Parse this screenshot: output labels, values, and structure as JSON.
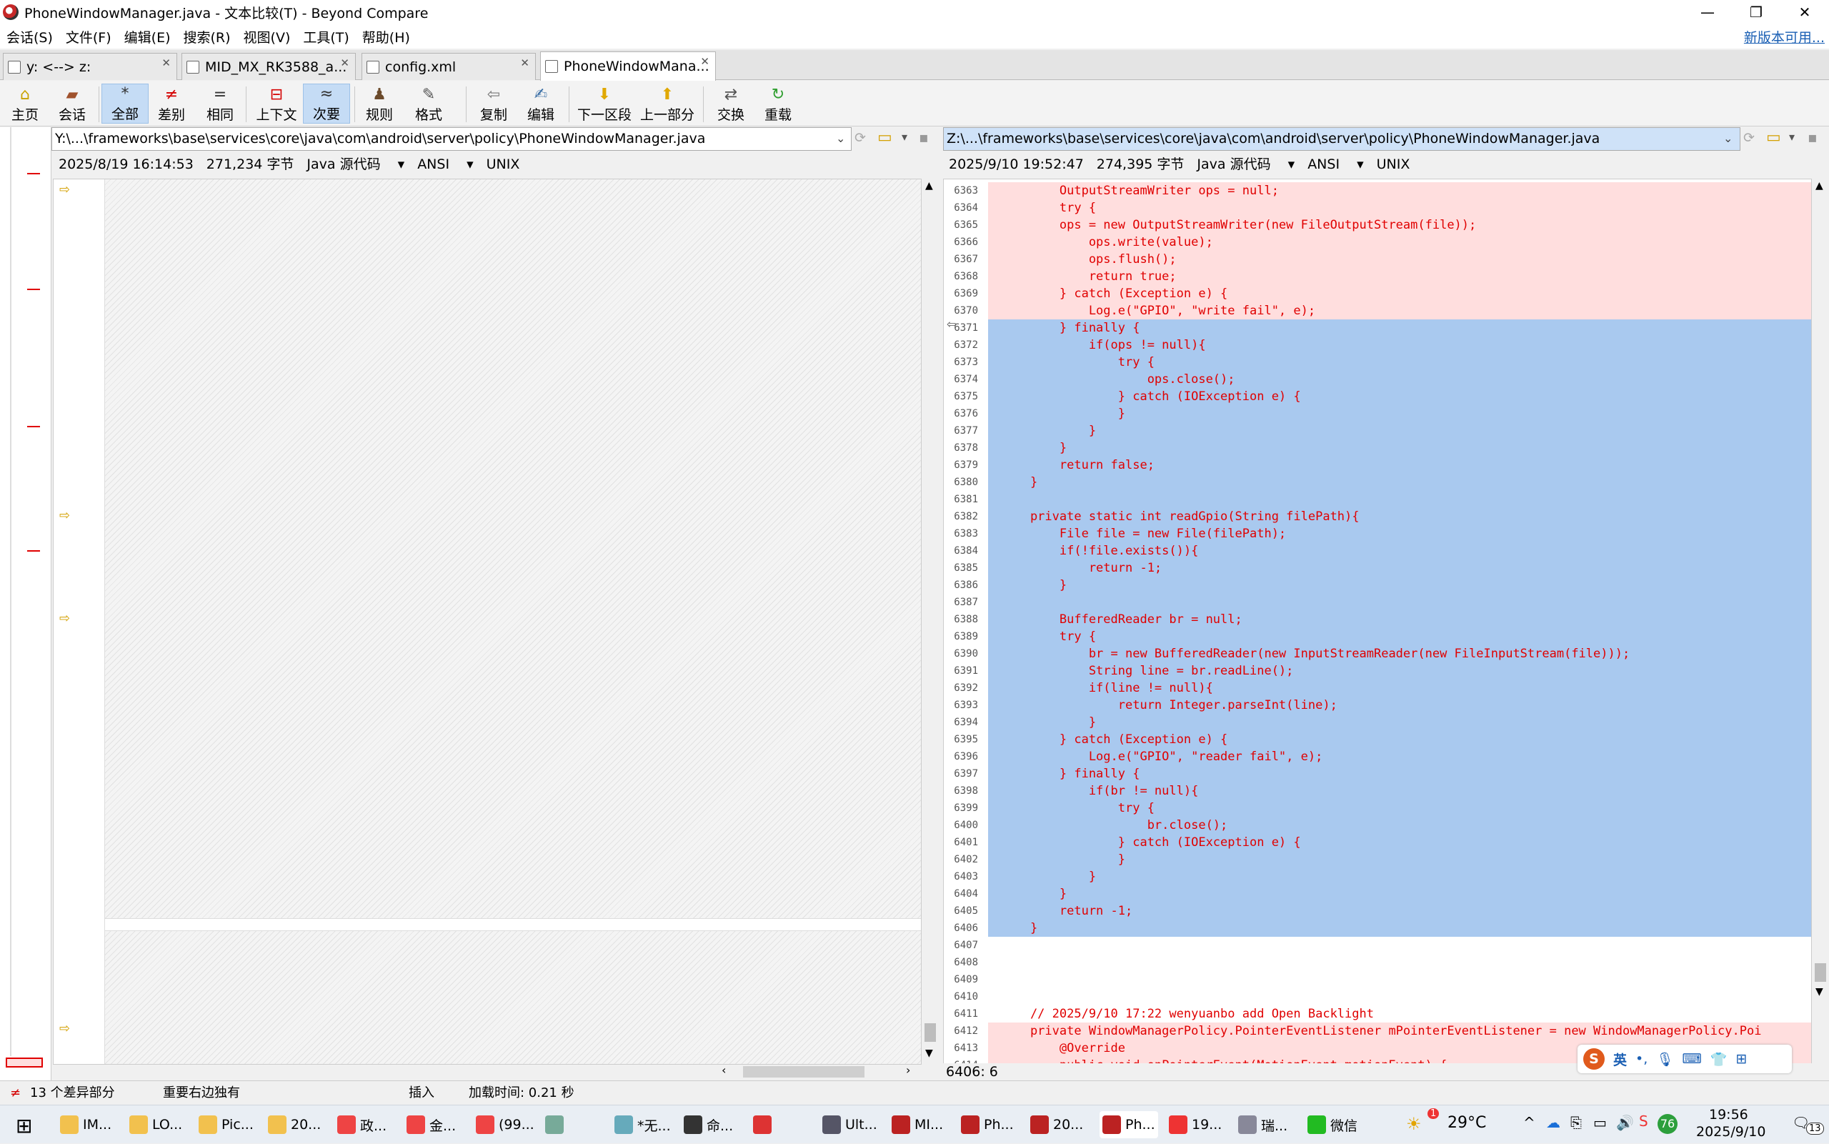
{
  "window": {
    "title": "PhoneWindowManager.java - 文本比较(T) - Beyond Compare"
  },
  "menu": {
    "items": [
      "会话(S)",
      "文件(F)",
      "编辑(E)",
      "搜索(R)",
      "视图(V)",
      "工具(T)",
      "帮助(H)"
    ],
    "new_version": "新版本可用..."
  },
  "tabs": [
    "y: <--> z:",
    "MID_MX_RK3588_a...",
    "config.xml",
    "PhoneWindowMana..."
  ],
  "toolbar": {
    "home": "主页",
    "session": "会话",
    "all": "全部",
    "diffs": "差别",
    "same": "相同",
    "context": "上下文",
    "minor": "次要",
    "rules": "规则",
    "format": "格式",
    "copy": "复制",
    "edit": "编辑",
    "next_section": "下一区段",
    "prev_section": "上一部分",
    "swap": "交换",
    "reload": "重载"
  },
  "left": {
    "path": "Y:\\...\\frameworks\\base\\services\\core\\java\\com\\android\\server\\policy\\PhoneWindowManager.java",
    "date": "2025/8/19 16:14:53",
    "size": "271,234 字节",
    "format": "Java 源代码",
    "encoding": "ANSI",
    "eol": "UNIX"
  },
  "right": {
    "path": "Z:\\...\\frameworks\\base\\services\\core\\java\\com\\android\\server\\policy\\PhoneWindowManager.java",
    "date": "2025/9/10 19:52:47",
    "size": "274,395 字节",
    "format": "Java 源代码",
    "encoding": "ANSI",
    "eol": "UNIX"
  },
  "code": [
    {
      "n": "6363",
      "t": "        OutputStreamWriter ops = null;",
      "s": "pink"
    },
    {
      "n": "6364",
      "t": "        try {",
      "s": "pink"
    },
    {
      "n": "6365",
      "t": "        ops = new OutputStreamWriter(new FileOutputStream(file));",
      "s": "pink"
    },
    {
      "n": "6366",
      "t": "            ops.write(value);",
      "s": "pink"
    },
    {
      "n": "6367",
      "t": "            ops.flush();",
      "s": "pink"
    },
    {
      "n": "6368",
      "t": "            return true;",
      "s": "pink"
    },
    {
      "n": "6369",
      "t": "        } catch (Exception e) {",
      "s": "pink"
    },
    {
      "n": "6370",
      "t": "            Log.e(\"GPIO\", \"write fail\", e);",
      "s": "pink"
    },
    {
      "n": "6371",
      "t": "        } finally {",
      "s": "blue"
    },
    {
      "n": "6372",
      "t": "            if(ops != null){",
      "s": "blue"
    },
    {
      "n": "6373",
      "t": "                try {",
      "s": "blue"
    },
    {
      "n": "6374",
      "t": "                    ops.close();",
      "s": "blue"
    },
    {
      "n": "6375",
      "t": "                } catch (IOException e) {",
      "s": "blue"
    },
    {
      "n": "6376",
      "t": "                }",
      "s": "blue"
    },
    {
      "n": "6377",
      "t": "            }",
      "s": "blue"
    },
    {
      "n": "6378",
      "t": "        }",
      "s": "blue"
    },
    {
      "n": "6379",
      "t": "        return false;",
      "s": "blue"
    },
    {
      "n": "6380",
      "t": "    }",
      "s": "blue"
    },
    {
      "n": "6381",
      "t": "",
      "s": "blue"
    },
    {
      "n": "6382",
      "t": "    private static int readGpio(String filePath){",
      "s": "blue"
    },
    {
      "n": "6383",
      "t": "        File file = new File(filePath);",
      "s": "blue"
    },
    {
      "n": "6384",
      "t": "        if(!file.exists()){",
      "s": "blue"
    },
    {
      "n": "6385",
      "t": "            return -1;",
      "s": "blue"
    },
    {
      "n": "6386",
      "t": "        }",
      "s": "blue"
    },
    {
      "n": "6387",
      "t": "",
      "s": "blue"
    },
    {
      "n": "6388",
      "t": "        BufferedReader br = null;",
      "s": "blue"
    },
    {
      "n": "6389",
      "t": "        try {",
      "s": "blue"
    },
    {
      "n": "6390",
      "t": "            br = new BufferedReader(new InputStreamReader(new FileInputStream(file)));",
      "s": "blue"
    },
    {
      "n": "6391",
      "t": "            String line = br.readLine();",
      "s": "blue"
    },
    {
      "n": "6392",
      "t": "            if(line != null){",
      "s": "blue"
    },
    {
      "n": "6393",
      "t": "                return Integer.parseInt(line);",
      "s": "blue"
    },
    {
      "n": "6394",
      "t": "            }",
      "s": "blue"
    },
    {
      "n": "6395",
      "t": "        } catch (Exception e) {",
      "s": "blue"
    },
    {
      "n": "6396",
      "t": "            Log.e(\"GPIO\", \"reader fail\", e);",
      "s": "blue"
    },
    {
      "n": "6397",
      "t": "        } finally {",
      "s": "blue"
    },
    {
      "n": "6398",
      "t": "            if(br != null){",
      "s": "blue"
    },
    {
      "n": "6399",
      "t": "                try {",
      "s": "blue"
    },
    {
      "n": "6400",
      "t": "                    br.close();",
      "s": "blue"
    },
    {
      "n": "6401",
      "t": "                } catch (IOException e) {",
      "s": "blue"
    },
    {
      "n": "6402",
      "t": "                }",
      "s": "blue"
    },
    {
      "n": "6403",
      "t": "            }",
      "s": "blue"
    },
    {
      "n": "6404",
      "t": "        }",
      "s": "blue"
    },
    {
      "n": "6405",
      "t": "        return -1;",
      "s": "blue"
    },
    {
      "n": "6406",
      "t": "    }",
      "s": "blue"
    },
    {
      "n": "6407",
      "t": "",
      "s": "plain"
    },
    {
      "n": "6408",
      "t": "",
      "s": "plain"
    },
    {
      "n": "6409",
      "t": "",
      "s": "plain"
    },
    {
      "n": "6410",
      "t": "",
      "s": "plain"
    },
    {
      "n": "6411",
      "t": "    // 2025/9/10 17:22 wenyuanbo add Open Backlight",
      "s": "plainred"
    },
    {
      "n": "6412",
      "t": "    private WindowManagerPolicy.PointerEventListener mPointerEventListener = new WindowManagerPolicy.Poi",
      "s": "pink"
    },
    {
      "n": "6413",
      "t": "        @Override",
      "s": "pink"
    },
    {
      "n": "6414",
      "t": "        public void onPointerEvent(MotionEvent motionEvent) {",
      "s": "pink"
    }
  ],
  "status": {
    "diff_count": "13 个差异部分",
    "right_only": "重要右边独有",
    "mode": "插入",
    "load_time": "加载时间: 0.21 秒",
    "cursor": "6406: 6"
  },
  "ime": {
    "lang": "英"
  },
  "taskbar": {
    "items": [
      "IM...",
      "LO...",
      "Pic...",
      "20...",
      "政...",
      "金...",
      "(99...",
      "",
      "*无...",
      "命...",
      "",
      "Ult...",
      "MI...",
      "Ph...",
      "20...",
      "Ph...",
      "19...",
      "瑞...",
      "微信"
    ],
    "temp": "29°C",
    "time": "19:56",
    "date": "2025/9/10",
    "notif": "13",
    "badge": "76"
  }
}
